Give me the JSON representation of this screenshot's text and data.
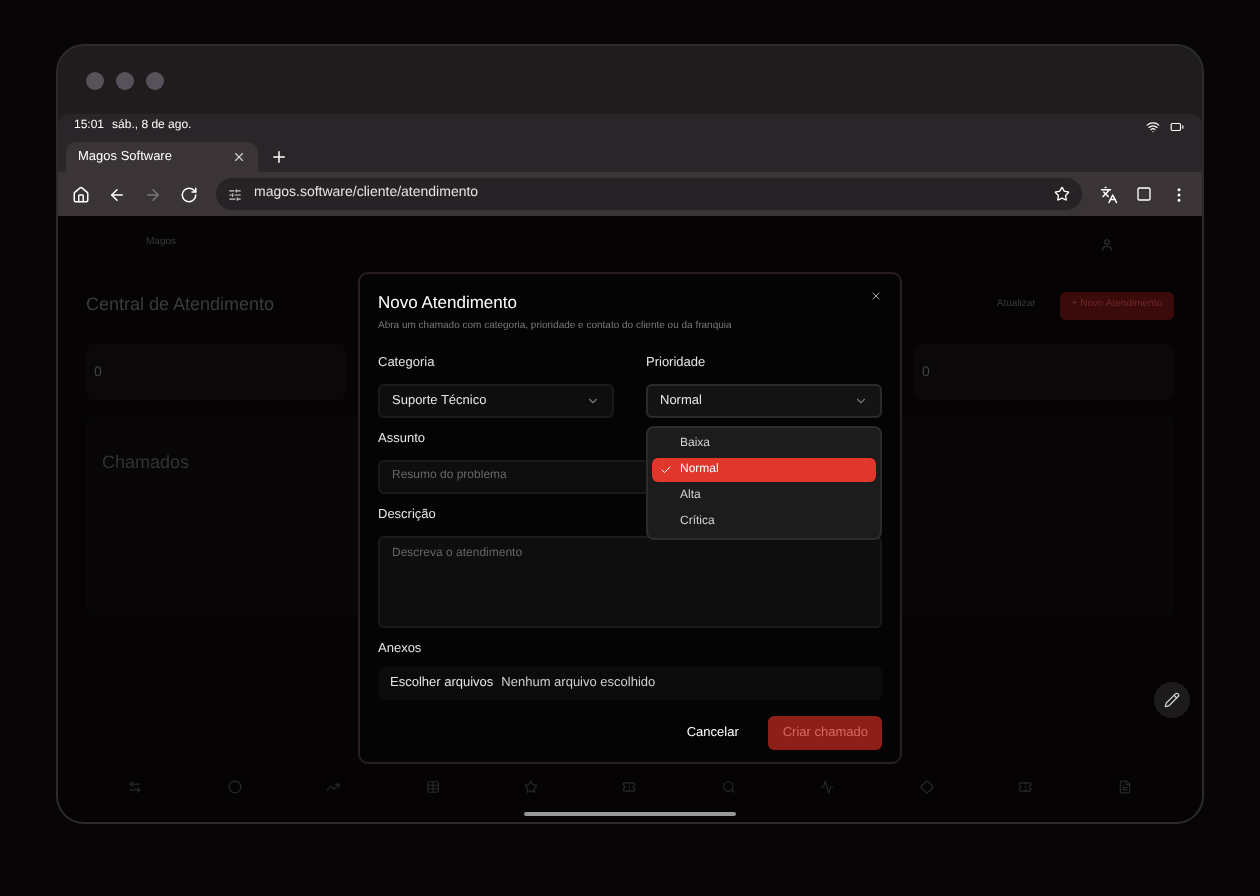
{
  "status_bar": {
    "time": "15:01",
    "date": "sáb., 8 de ago."
  },
  "browser": {
    "tab": {
      "title": "Magos Software"
    },
    "url": "magos.software/cliente/atendimento"
  },
  "page": {
    "brand": "Magos",
    "title": "Central de Atendimento",
    "actions": [
      {
        "label": "Atualizar",
        "kind": "ghost"
      },
      {
        "label": "+ Novo Atendimento",
        "kind": "primary"
      }
    ],
    "stats": [
      {
        "value": "0"
      },
      {
        "value": "0"
      }
    ],
    "section_title": "Chamados"
  },
  "dialog": {
    "title": "Novo Atendimento",
    "description": "Abra um chamado com categoria, prioridade e contato do cliente ou da franquia",
    "fields": [
      {
        "kind": "select",
        "label": "Categoria",
        "value": "Suporte Técnico",
        "expanded": false
      },
      {
        "kind": "select",
        "label": "Prioridade",
        "value": "Normal",
        "expanded": true,
        "options": [
          {
            "label": "Baixa",
            "selected": false
          },
          {
            "label": "Normal",
            "selected": true
          },
          {
            "label": "Alta",
            "selected": false
          },
          {
            "label": "Crítica",
            "selected": false
          }
        ]
      },
      {
        "kind": "input",
        "label": "Assunto",
        "placeholder": "Resumo do problema"
      },
      {
        "kind": "textarea",
        "label": "Descrição",
        "placeholder": "Descreva o atendimento"
      },
      {
        "kind": "file",
        "label": "Anexos",
        "button": "Escolher arquivos",
        "status": "Nenhum arquivo escolhido"
      }
    ],
    "buttons": [
      {
        "label": "Cancelar",
        "kind": "ghost",
        "disabled": false
      },
      {
        "label": "Criar chamado",
        "kind": "primary",
        "disabled": true
      }
    ]
  }
}
